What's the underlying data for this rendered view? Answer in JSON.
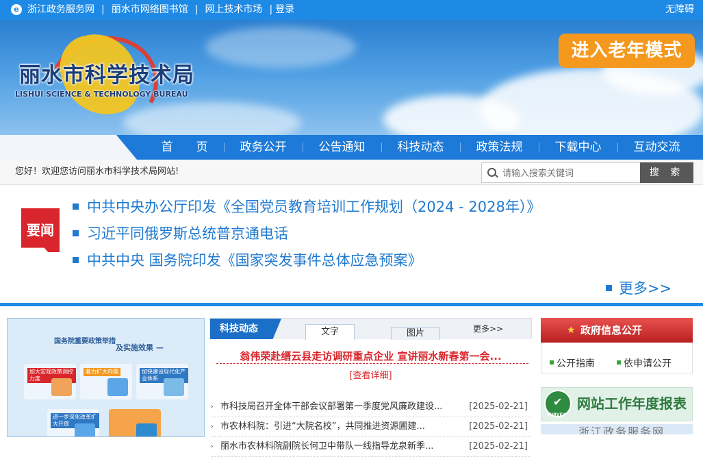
{
  "topbar": {
    "links": [
      "浙江政务服务网",
      "丽水市网络图书馆",
      "网上技术市场",
      "登录"
    ],
    "accessibility": "无障碍"
  },
  "banner": {
    "title": "丽水市科学技术局",
    "subtitle": "LISHUI SCIENCE & TECHNOLOGY BUREAU",
    "elder_mode": "进入老年模式"
  },
  "nav": [
    "首　　页",
    "政务公开",
    "公告通知",
    "科技动态",
    "政策法规",
    "下载中心",
    "互动交流"
  ],
  "welcome": "您好！欢迎您访问丽水市科学技术局网站!",
  "search": {
    "placeholder": "请输入搜索关键词",
    "button": "搜 索"
  },
  "headlines": {
    "badge": "要闻",
    "items": [
      "中共中央办公厅印发《全国党员教育培训工作规划（2024 - 2028年）》",
      "习近平同俄罗斯总统普京通电话",
      "中共中央  国务院印发《国家突发事件总体应急预案》"
    ],
    "more": "更多>>"
  },
  "policy_panel": {
    "title": "国务院重要政策举措",
    "title2": "及实施效果 —",
    "cards": [
      "加大宏观政策调控力度",
      "着力扩大内需",
      "加快建设现代化产业体系",
      "进一步深化改革扩大开放",
      ""
    ]
  },
  "news": {
    "tab_main": "科技动态",
    "tab_text": "文字",
    "tab_image": "图片",
    "more": "更多>>",
    "feature_title": "翁伟荣赴缙云县走访调研重点企业 宣讲丽水新春第一会...",
    "detail": "[查看详细]",
    "items": [
      {
        "title": "市科技局召开全体干部会议部署第一季度党风廉政建设...",
        "date": "[2025-02-21]"
      },
      {
        "title": "市农林科院：引进“大院名校”，共同推进资源圃建...",
        "date": "[2025-02-21]"
      },
      {
        "title": "丽水市农林科院副院长何卫中带队一线指导龙泉新季...",
        "date": "[2025-02-21]"
      }
    ]
  },
  "gov_info": {
    "title": "政府信息公开",
    "links": [
      "公开指南",
      "依申请公开"
    ]
  },
  "annual_report": {
    "title": "网站工作年度报表",
    "badge": "SURVEY"
  },
  "bottom_strip": "浙江政务服务网"
}
